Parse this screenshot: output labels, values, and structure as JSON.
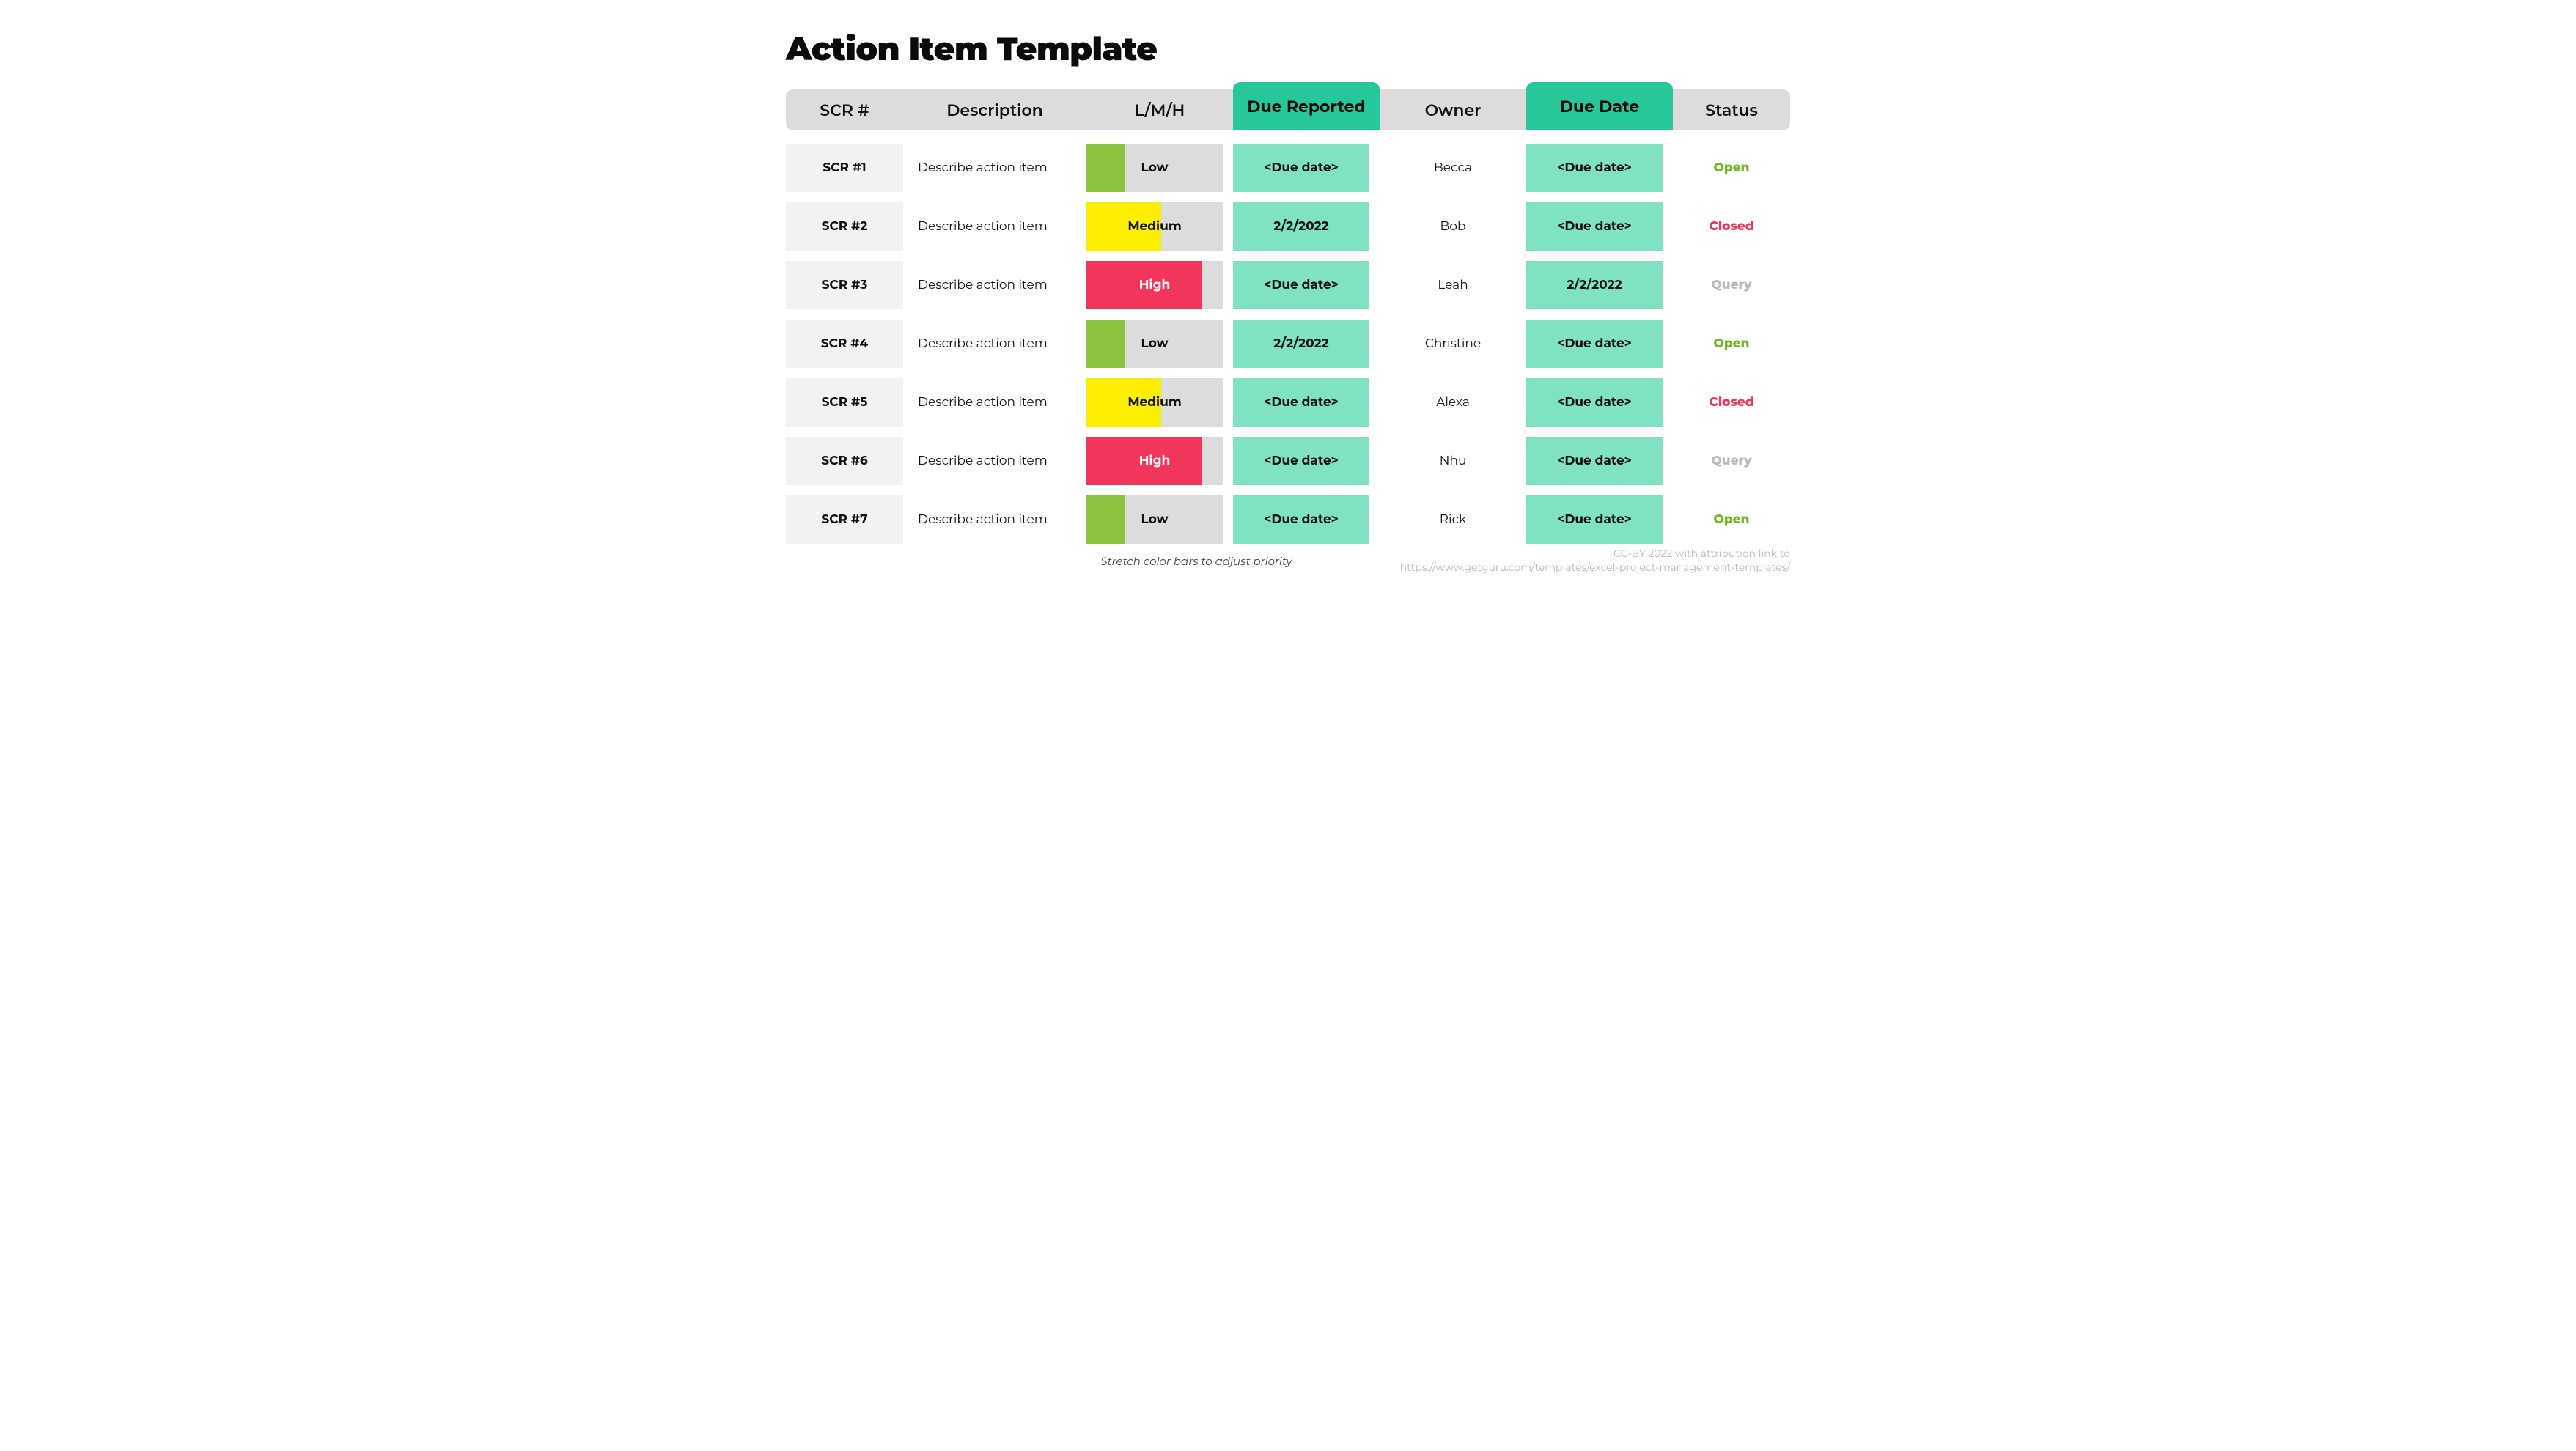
{
  "title": "Action Item Template",
  "headers": {
    "scr": "SCR #",
    "description": "Description",
    "lmh": "L/M/H",
    "due_reported": "Due Reported",
    "owner": "Owner",
    "due_date": "Due Date",
    "status": "Status"
  },
  "rows": [
    {
      "scr": "SCR #1",
      "description": "Describe action item",
      "priority": "Low",
      "priority_level": "low",
      "due_reported": "<Due date>",
      "owner": "Becca",
      "due_date": "<Due date>",
      "status": "Open",
      "status_class": "open"
    },
    {
      "scr": "SCR #2",
      "description": "Describe action item",
      "priority": "Medium",
      "priority_level": "medium",
      "due_reported": "2/2/2022",
      "owner": "Bob",
      "due_date": "<Due date>",
      "status": "Closed",
      "status_class": "closed"
    },
    {
      "scr": "SCR #3",
      "description": "Describe action item",
      "priority": "High",
      "priority_level": "high",
      "due_reported": "<Due date>",
      "owner": "Leah",
      "due_date": "2/2/2022",
      "status": "Query",
      "status_class": "query"
    },
    {
      "scr": "SCR #4",
      "description": "Describe action item",
      "priority": "Low",
      "priority_level": "low",
      "due_reported": "2/2/2022",
      "owner": "Christine",
      "due_date": "<Due date>",
      "status": "Open",
      "status_class": "open"
    },
    {
      "scr": "SCR #5",
      "description": "Describe action item",
      "priority": "Medium",
      "priority_level": "medium",
      "due_reported": "<Due date>",
      "owner": "Alexa",
      "due_date": "<Due date>",
      "status": "Closed",
      "status_class": "closed"
    },
    {
      "scr": "SCR #6",
      "description": "Describe action item",
      "priority": "High",
      "priority_level": "high",
      "due_reported": "<Due date>",
      "owner": "Nhu",
      "due_date": "<Due date>",
      "status": "Query",
      "status_class": "query"
    },
    {
      "scr": "SCR #7",
      "description": "Describe action item",
      "priority": "Low",
      "priority_level": "low",
      "due_reported": "<Due date>",
      "owner": "Rick",
      "due_date": "<Due date>",
      "status": "Open",
      "status_class": "open"
    }
  ],
  "hint": "Stretch color bars to adjust priority",
  "credit": {
    "license": "CC-BY",
    "rest": " 2022 with attribution link to",
    "url": "https://www.getguru.com/templates/excel-project-management-templates/"
  }
}
